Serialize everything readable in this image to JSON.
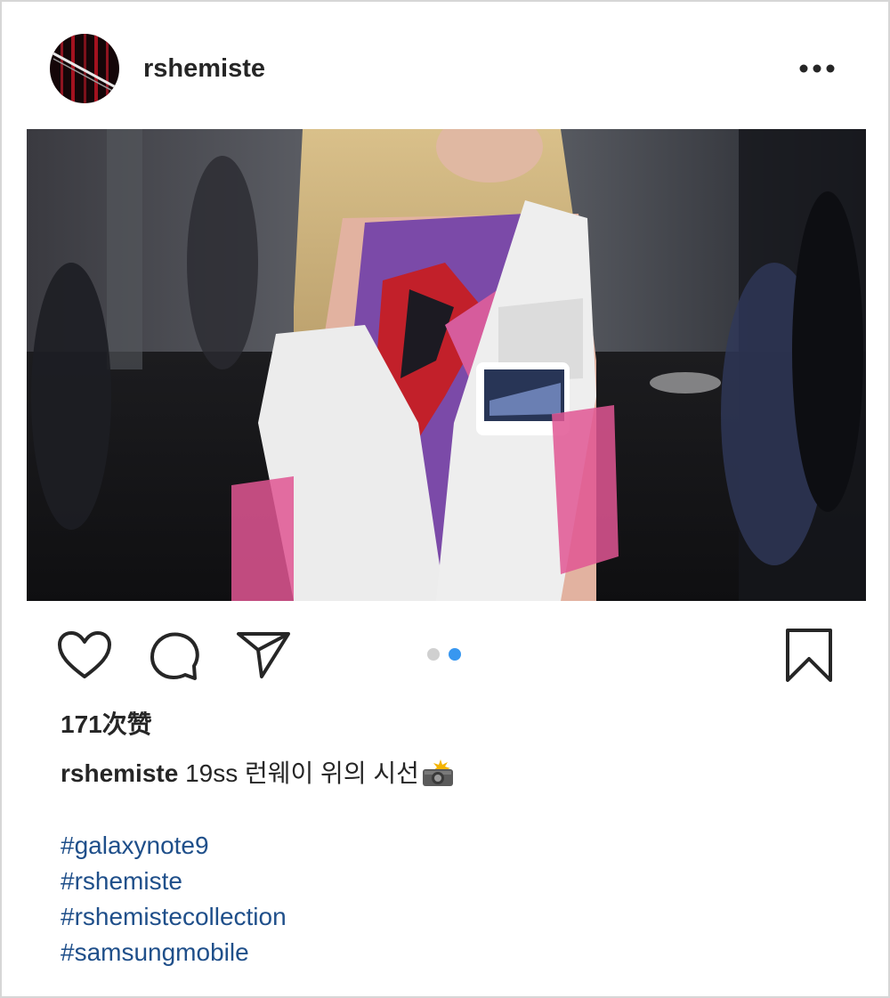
{
  "post": {
    "username": "rshemiste",
    "likes_text": "171次赞",
    "caption_user": "rshemiste",
    "caption_text": "19ss 런웨이 위의 시선",
    "caption_emoji": "camera-flash-emoji",
    "hashtags": [
      "#galaxynote9",
      "#rshemiste",
      "#rshemistecollection",
      "#samsungmobile"
    ],
    "carousel": {
      "count": 2,
      "active_index": 1
    }
  },
  "icons": {
    "more": "more-options-icon",
    "like": "heart-icon",
    "comment": "comment-bubble-icon",
    "share": "paper-plane-icon",
    "save": "bookmark-icon"
  },
  "colors": {
    "hashtag": "#1f4f8a",
    "active_dot": "#3897f0",
    "inactive_dot": "#d0d0d0",
    "text": "#262626"
  }
}
